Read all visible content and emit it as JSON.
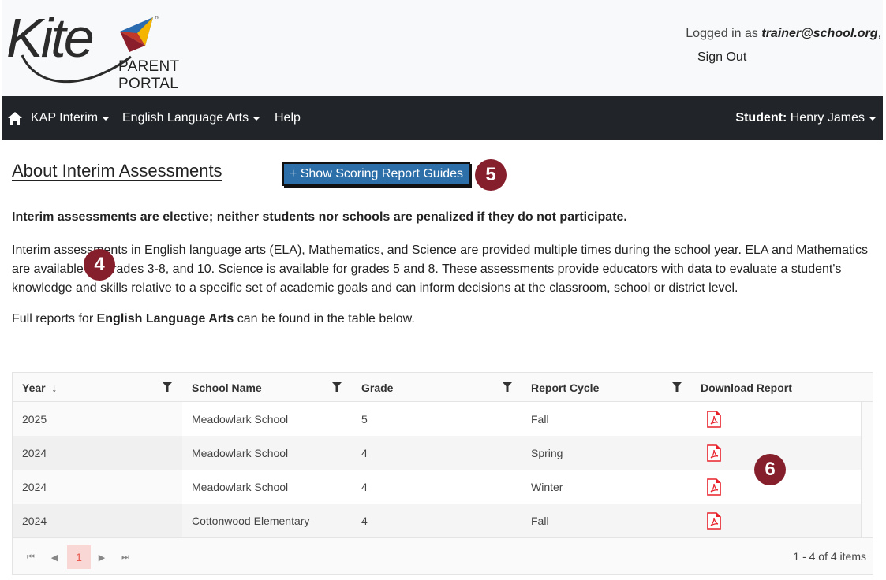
{
  "header": {
    "logo_word": "Kite",
    "logo_subtitle": "PARENT PORTAL",
    "logged_in_prefix": "Logged in as ",
    "user_email": "trainer@school.org",
    "logged_in_suffix": ",",
    "sign_out": "Sign Out"
  },
  "nav": {
    "home_icon": "home-icon",
    "items": [
      {
        "label": "KAP Interim",
        "dropdown": true
      },
      {
        "label": "English Language Arts",
        "dropdown": true
      },
      {
        "label": "Help",
        "dropdown": false
      }
    ],
    "student_label": "Student:",
    "student_name": "Henry James"
  },
  "main": {
    "title": "About Interim Assessments",
    "guides_button": "+ Show Scoring Report Guides",
    "notice": "Interim assessments are elective; neither students nor schools are penalized if they do not participate.",
    "paragraph": "Interim assessments in English language arts (ELA), Mathematics, and Science are provided multiple times during the school year. ELA and Mathematics are available for grades 3-8, and 10. Science is available for grades 5 and 8. These assessments provide educators with data to evaluate a student's knowledge and skills relative to a specific set of academic goals and can inform decisions at the classroom, school or district level.",
    "reports_prefix": "Full reports for ",
    "reports_subject": "English Language Arts",
    "reports_suffix": " can be found in the table below."
  },
  "callouts": {
    "badge_4": "4",
    "badge_5": "5",
    "badge_6": "6"
  },
  "table": {
    "columns": [
      "Year",
      "School Name",
      "Grade",
      "Report Cycle",
      "Download Report"
    ],
    "sort_indicator": "↓",
    "rows": [
      {
        "year": "2025",
        "school": "Meadowlark School",
        "grade": "5",
        "cycle": "Fall",
        "download": "pdf-icon"
      },
      {
        "year": "2024",
        "school": "Meadowlark School",
        "grade": "4",
        "cycle": "Spring",
        "download": "pdf-icon"
      },
      {
        "year": "2024",
        "school": "Meadowlark School",
        "grade": "4",
        "cycle": "Winter",
        "download": "pdf-icon"
      },
      {
        "year": "2024",
        "school": "Cottonwood Elementary",
        "grade": "4",
        "cycle": "Fall",
        "download": "pdf-icon"
      }
    ],
    "pager": {
      "current_page": "1",
      "info": "1 - 4 of 4 items"
    }
  },
  "colors": {
    "navbar": "#212529",
    "button": "#2d6fa8",
    "badge": "#861f2c",
    "pdf": "#e8202a"
  }
}
